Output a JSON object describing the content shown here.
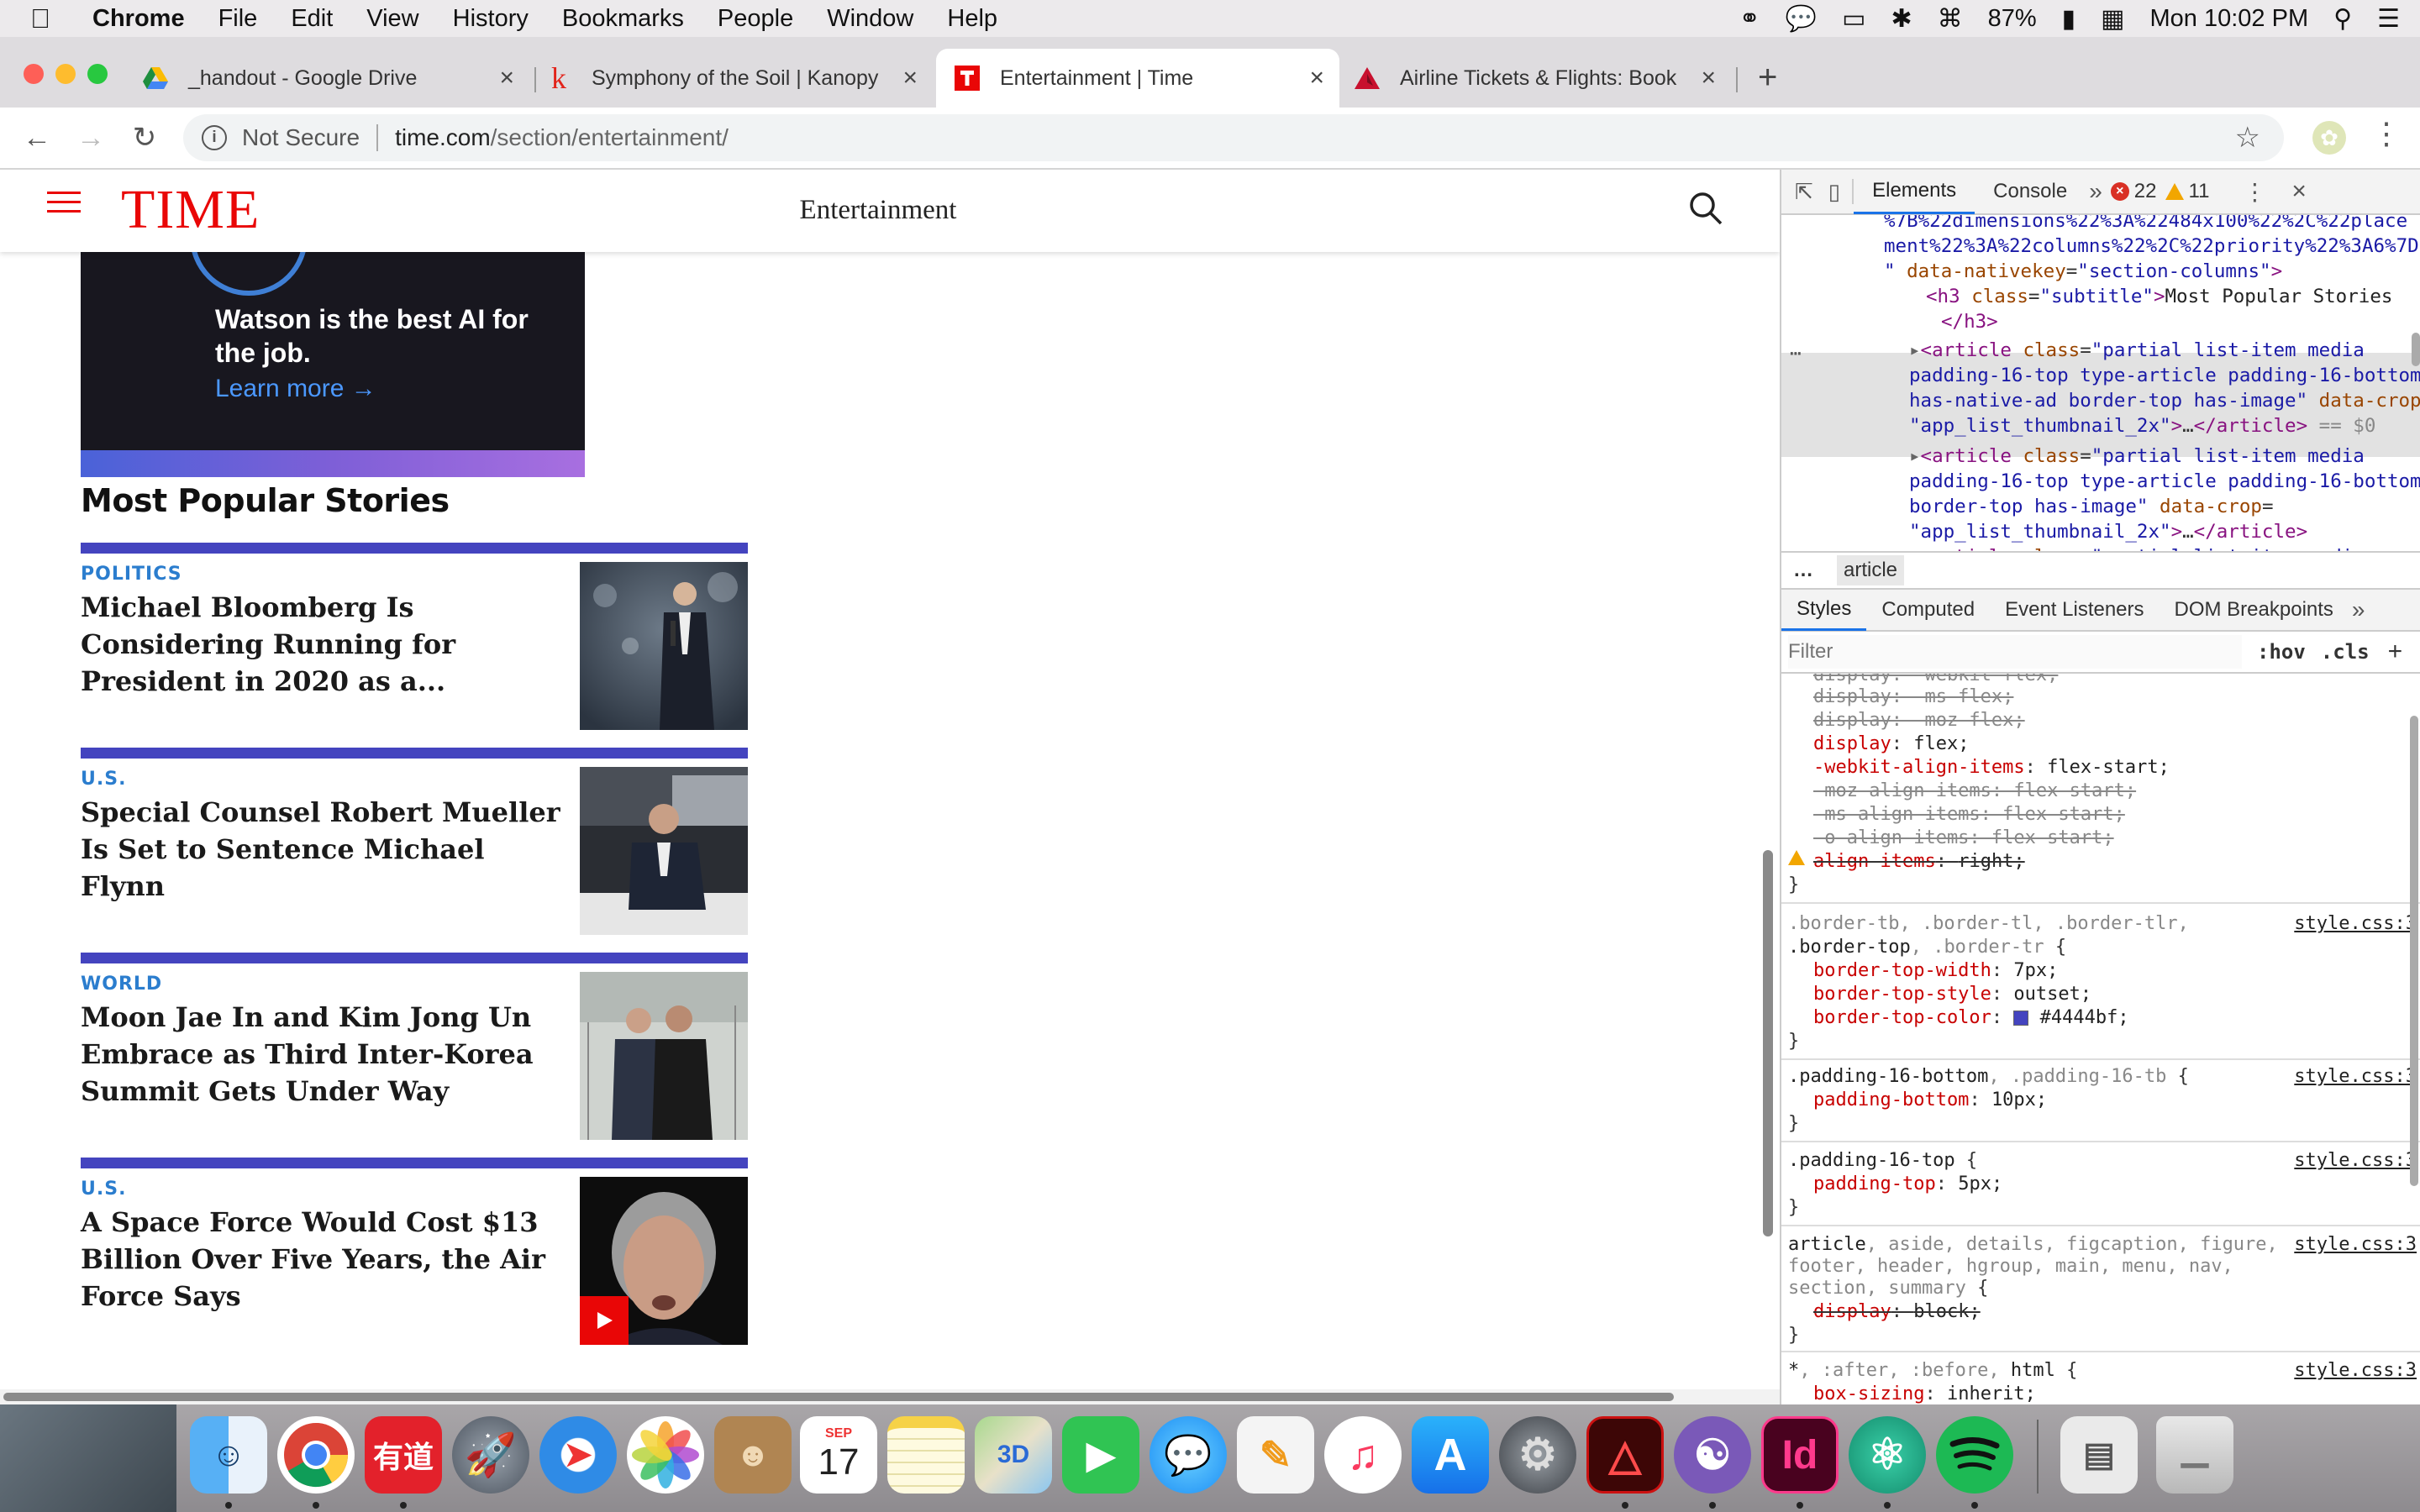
{
  "menubar": {
    "app": "Chrome",
    "items": [
      "File",
      "Edit",
      "View",
      "History",
      "Bookmarks",
      "People",
      "Window",
      "Help"
    ],
    "battery": "87%",
    "clock": "Mon 10:02 PM"
  },
  "tabs": [
    {
      "title": "_handout - Google Drive",
      "icon": "google-drive-icon"
    },
    {
      "title": "Symphony of the Soil | Kanopy",
      "icon": "kanopy-icon"
    },
    {
      "title": "Entertainment | Time",
      "icon": "time-icon",
      "active": true
    },
    {
      "title": "Airline Tickets & Flights: Book",
      "icon": "delta-icon"
    }
  ],
  "omnibox": {
    "security": "Not Secure",
    "host": "time.com",
    "path": "/section/entertainment/"
  },
  "site": {
    "logo": "TIME",
    "section": "Entertainment"
  },
  "ad": {
    "headline": "Watson is the best AI for the job.",
    "cta": "Learn more →"
  },
  "most_popular": {
    "heading": "Most Popular Stories",
    "stories": [
      {
        "category": "POLITICS",
        "title": "Michael Bloomberg Is Considering Running for President in 2020 as a..."
      },
      {
        "category": "U.S.",
        "title": "Special Counsel Robert Mueller Is Set to Sentence Michael Flynn"
      },
      {
        "category": "WORLD",
        "title": "Moon Jae In and Kim Jong Un Embrace as Third Inter-Korea Summit Gets Under Way"
      },
      {
        "category": "U.S.",
        "title": "A Space Force Would Cost $13 Billion Over Five Years, the Air Force Says"
      }
    ]
  },
  "devtools": {
    "tabs": [
      "Elements",
      "Console"
    ],
    "errors": "22",
    "warnings": "11",
    "breadcrumb": "article",
    "style_tabs": [
      "Styles",
      "Computed",
      "Event Listeners",
      "DOM Breakpoints"
    ],
    "filter_placeholder": "Filter",
    "hov": ":hov",
    "cls": ".cls",
    "source_file": "style.css:3",
    "border_color": "#4444bf"
  },
  "dock": {
    "calendar_month": "SEP",
    "calendar_day": "17"
  }
}
